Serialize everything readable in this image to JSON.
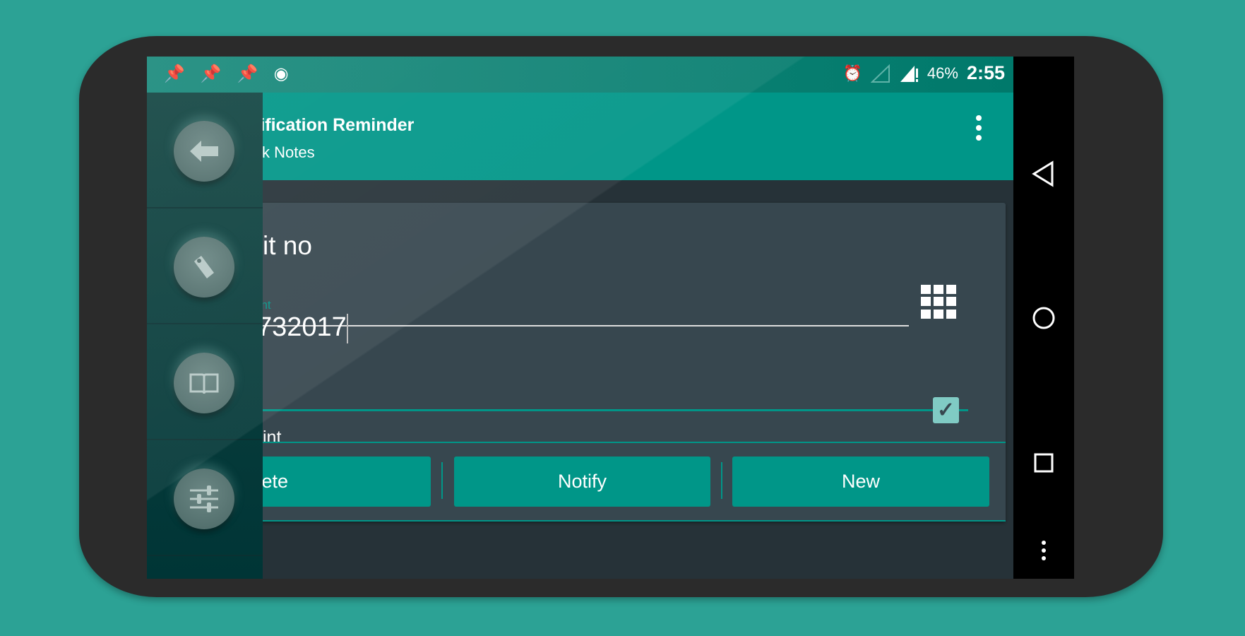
{
  "status_bar": {
    "left_icons": [
      "pin-icon",
      "pin-icon",
      "pin-icon",
      "cyanogenmod-icon"
    ],
    "battery": "46%",
    "time": "2:55",
    "right_icons": [
      "alarm-icon",
      "signal-empty-icon",
      "signal-alert-icon"
    ]
  },
  "toolbar": {
    "title": "tification Reminder",
    "subtitle": "ck Notes",
    "menu_icon": "more-vert-icon"
  },
  "form": {
    "field1_value": "it no",
    "field2_label": "ent",
    "field2_value": "732017",
    "field3_label": "int",
    "checkbox_checked": true
  },
  "buttons": {
    "delete": "Delete",
    "notify": "Notify",
    "new": "New"
  },
  "drawer": {
    "items": [
      "back-arrow-icon",
      "tag-icon",
      "book-icon",
      "sliders-icon"
    ]
  },
  "nav_bar": [
    "back-icon",
    "home-icon",
    "recents-icon",
    "menu-icon"
  ],
  "colors": {
    "accent": "#009688",
    "card": "#37474f",
    "background": "#2ca295"
  }
}
